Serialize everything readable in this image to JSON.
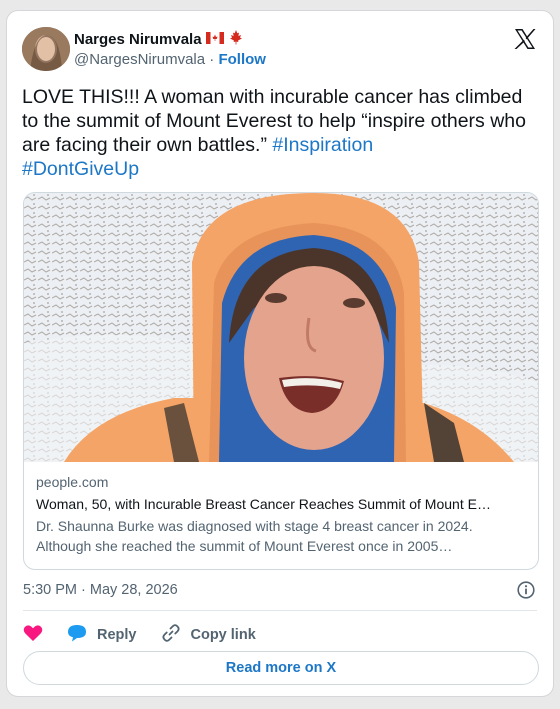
{
  "author": {
    "name": "Narges Nirumvala",
    "handle": "@NargesNirumvala",
    "separator": "·",
    "follow_label": "Follow",
    "flag_icon": "canada-flag-icon"
  },
  "tweet": {
    "text": "LOVE THIS!!! A woman with incurable cancer has climbed to the summit of Mount Everest to help “inspire others who are facing their own battles.” ",
    "hashtags": [
      "#Inspiration",
      "#DontGiveUp"
    ]
  },
  "link_card": {
    "domain": "people.com",
    "title": "Woman, 50, with Incurable Breast Cancer Reaches Summit of Mount E…",
    "description": "Dr. Shaunna Burke was diagnosed with stage 4 breast cancer in 2024. Although she reached the summit of Mount Everest once in 2005…"
  },
  "timestamp": "5:30 PM · May 28, 2026",
  "actions": {
    "reply_label": "Reply",
    "copy_label": "Copy link",
    "read_more_label": "Read more on X"
  },
  "colors": {
    "link": "#1d77c7",
    "like": "#f91880",
    "reply": "#1d9bf0",
    "jacket": "#f5a467"
  }
}
